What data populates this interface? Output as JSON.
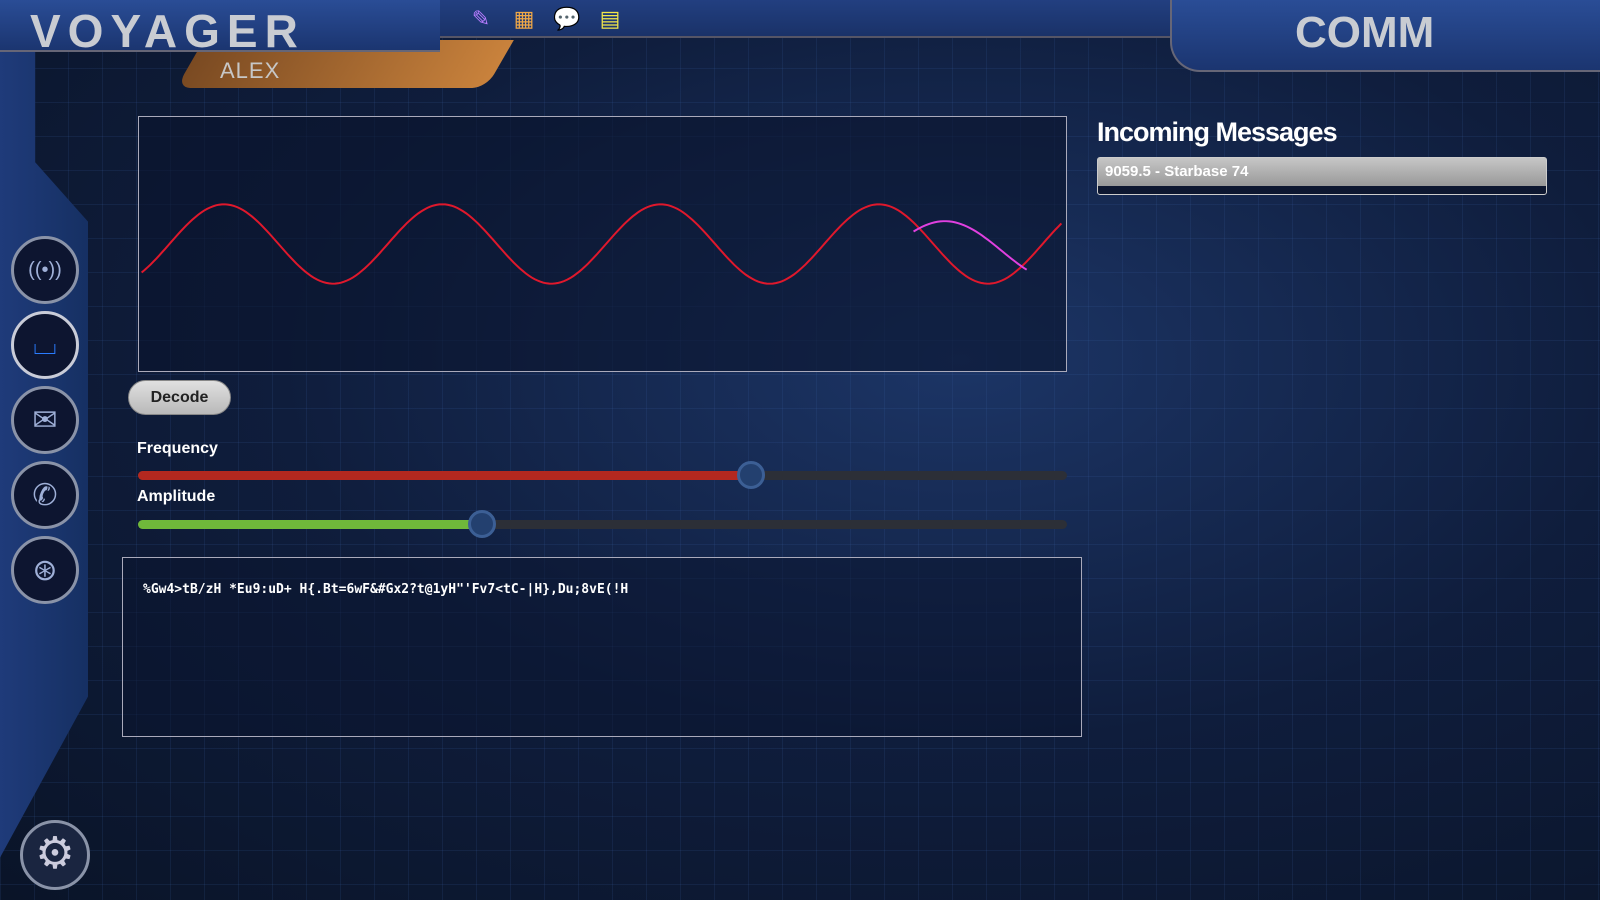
{
  "header": {
    "app_title": "VOYAGER",
    "user": "ALEX",
    "section": "COMM"
  },
  "toolbar": [
    {
      "icon": "edit-icon",
      "glyph": "✎",
      "color": "#b77cff"
    },
    {
      "icon": "calculator-icon",
      "glyph": "▦",
      "color": "#f0a848"
    },
    {
      "icon": "chat-icon",
      "glyph": "💬",
      "color": "#5aa0e8"
    },
    {
      "icon": "notebook-icon",
      "glyph": "▤",
      "color": "#f2e64a"
    }
  ],
  "sidebar": [
    {
      "icon": "broadcast-icon",
      "glyph": "((•))",
      "active": false
    },
    {
      "icon": "inbox-icon",
      "glyph": "⌴",
      "active": true
    },
    {
      "icon": "mail-icon",
      "glyph": "✉",
      "active": false
    },
    {
      "icon": "phone-icon",
      "glyph": "✆",
      "active": false
    },
    {
      "icon": "antenna-icon",
      "glyph": "⊛",
      "active": false
    }
  ],
  "settings_glyph": "⚙",
  "controls": {
    "decode_label": "Decode",
    "frequency_label": "Frequency",
    "frequency_value": 0.66,
    "frequency_color": "#b3281f",
    "amplitude_label": "Amplitude",
    "amplitude_value": 0.37,
    "amplitude_color": "#6fb83a"
  },
  "output_text": "%Gw4>tB/zH *Eu9:uD+ H{.Bt=6wF&#Gx2?t@1yH\"'Fv7<tC-|H},Du;8vE(!H",
  "messages": {
    "title": "Incoming Messages",
    "items": [
      "9059.5 - Starbase 74"
    ]
  },
  "wave": {
    "color": "#e0182c",
    "match_color": "#e040e0"
  }
}
